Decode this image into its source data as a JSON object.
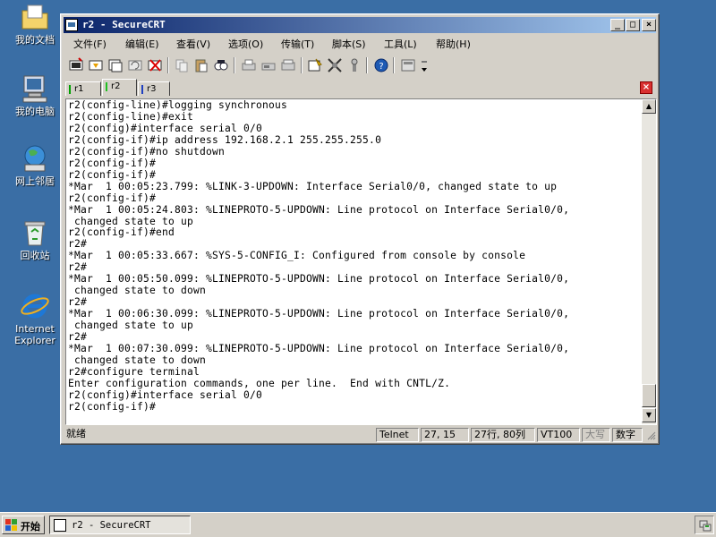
{
  "desktop": {
    "icons": [
      {
        "label": "我的文档"
      },
      {
        "label": "我的电脑"
      },
      {
        "label": "网上邻居"
      },
      {
        "label": "回收站"
      },
      {
        "label_line1": "Internet",
        "label_line2": "Explorer"
      }
    ]
  },
  "window": {
    "title": "r2 - SecureCRT",
    "buttons": {
      "minimize": "_",
      "maximize": "□",
      "close": "×"
    }
  },
  "menu": {
    "items": [
      {
        "label": "文件(F)"
      },
      {
        "label": "编辑(E)"
      },
      {
        "label": "查看(V)"
      },
      {
        "label": "选项(O)"
      },
      {
        "label": "传输(T)"
      },
      {
        "label": "脚本(S)"
      },
      {
        "label": "工具(L)"
      },
      {
        "label": "帮助(H)"
      }
    ]
  },
  "toolbar": {
    "icons": [
      "connect-icon",
      "quick-connect-icon",
      "connect-in-tab-icon",
      "reconnect-icon",
      "disconnect-icon",
      "copy-icon",
      "paste-icon",
      "find-icon",
      "print-icon",
      "print-selection-icon",
      "print-setup-icon",
      "session-options-icon",
      "global-options-icon",
      "keymap-icon",
      "help-icon",
      "toolbar-toggle-icon"
    ]
  },
  "tabs": [
    {
      "label": "r1",
      "color": "#00a000"
    },
    {
      "label": "r2",
      "color": "#20c020"
    },
    {
      "label": "r3",
      "color": "#2040c0"
    }
  ],
  "terminal": {
    "lines": [
      "r2(config-line)#logging synchronous",
      "r2(config-line)#exit",
      "r2(config)#interface serial 0/0",
      "r2(config-if)#ip address 192.168.2.1 255.255.255.0",
      "r2(config-if)#no shutdown",
      "r2(config-if)#",
      "r2(config-if)#",
      "*Mar  1 00:05:23.799: %LINK-3-UPDOWN: Interface Serial0/0, changed state to up",
      "r2(config-if)#",
      "*Mar  1 00:05:24.803: %LINEPROTO-5-UPDOWN: Line protocol on Interface Serial0/0,",
      " changed state to up",
      "r2(config-if)#end",
      "r2#",
      "*Mar  1 00:05:33.667: %SYS-5-CONFIG_I: Configured from console by console",
      "r2#",
      "*Mar  1 00:05:50.099: %LINEPROTO-5-UPDOWN: Line protocol on Interface Serial0/0,",
      " changed state to down",
      "r2#",
      "*Mar  1 00:06:30.099: %LINEPROTO-5-UPDOWN: Line protocol on Interface Serial0/0,",
      " changed state to up",
      "r2#",
      "*Mar  1 00:07:30.099: %LINEPROTO-5-UPDOWN: Line protocol on Interface Serial0/0,",
      " changed state to down",
      "r2#configure terminal",
      "Enter configuration commands, one per line.  End with CNTL/Z.",
      "r2(config)#interface serial 0/0",
      "r2(config-if)#"
    ]
  },
  "status": {
    "ready": "就绪",
    "protocol": "Telnet",
    "cursor": "27,  15",
    "size": "27行, 80列",
    "emulation": "VT100",
    "caps": "大写",
    "num": "数字"
  },
  "taskbar": {
    "start_label": "开始",
    "task_label": "r2 - SecureCRT"
  }
}
